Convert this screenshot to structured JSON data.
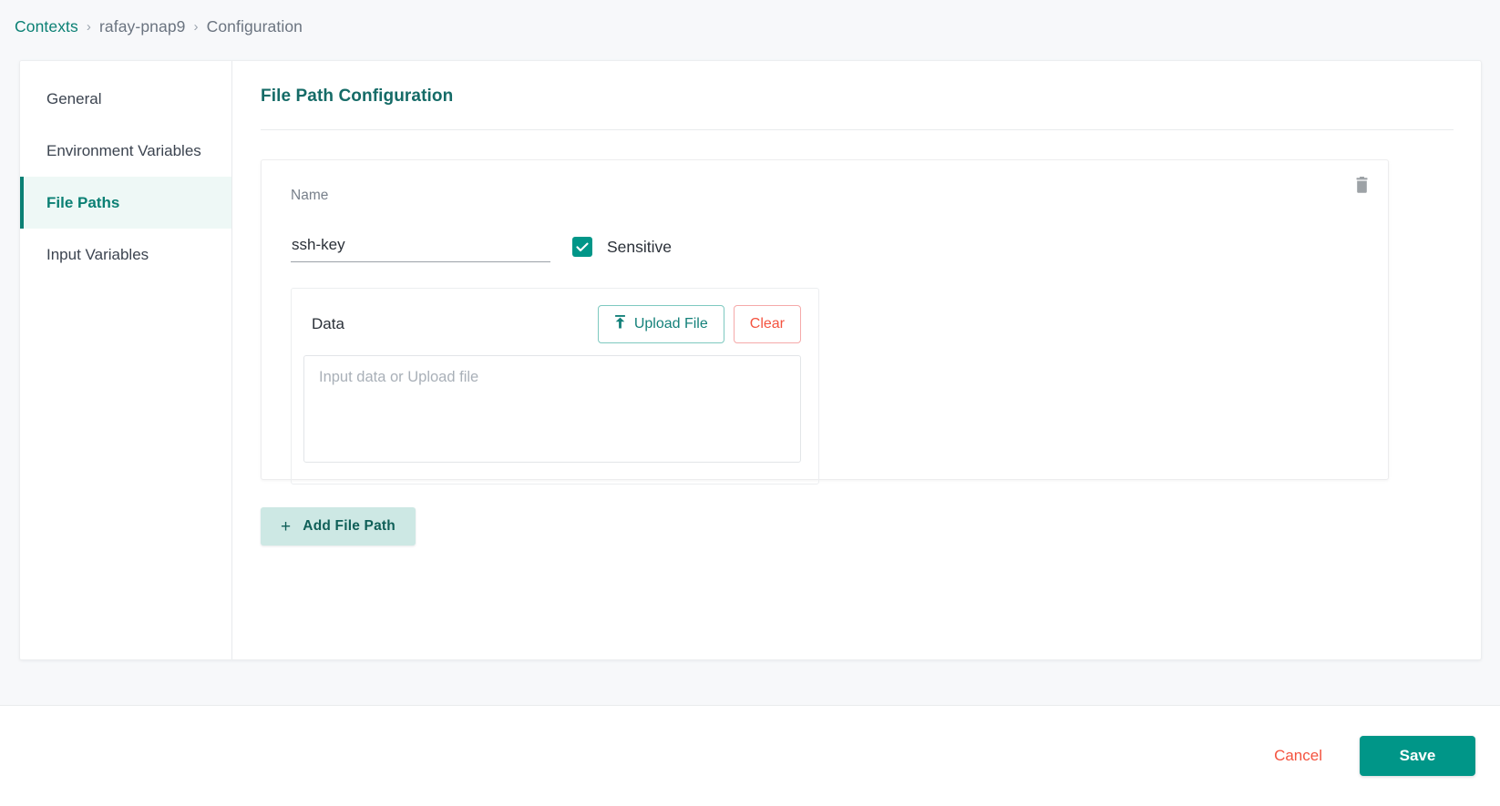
{
  "breadcrumb": {
    "root": "Contexts",
    "separator": "›",
    "context_name": "rafay-pnap9",
    "current": "Configuration"
  },
  "sidebar": {
    "items": [
      {
        "label": "General",
        "active": false
      },
      {
        "label": "Environment Variables",
        "active": false
      },
      {
        "label": "File Paths",
        "active": true
      },
      {
        "label": "Input Variables",
        "active": false
      }
    ]
  },
  "content": {
    "title": "File Path Configuration",
    "file_path": {
      "delete_icon": "trash-icon",
      "name_label": "Name",
      "name_value": "ssh-key",
      "name_placeholder": "Name",
      "sensitive_label": "Sensitive",
      "sensitive_checked": true,
      "data_label": "Data",
      "upload_button": "Upload File",
      "upload_icon": "upload-icon",
      "clear_button": "Clear",
      "data_value": "",
      "data_placeholder": "Input data or Upload file"
    },
    "add_button": "Add File Path",
    "add_icon": "plus-icon"
  },
  "footer": {
    "cancel_label": "Cancel",
    "save_label": "Save"
  },
  "colors": {
    "accent": "#009688",
    "accent_dark": "#0b8074",
    "danger": "#f4533f",
    "page_background": "#f7f8fa",
    "nav_active_background": "#eef8f6",
    "add_button_background": "#cde8e4"
  }
}
